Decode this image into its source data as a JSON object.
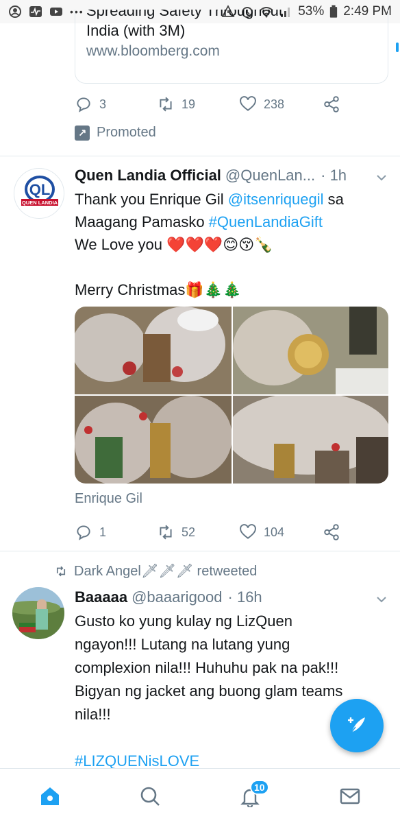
{
  "status_bar": {
    "battery": "53%",
    "time": "2:49 PM",
    "dots": "•••"
  },
  "promo_tweet": {
    "card_title_clipped": "Spreading Safety Throughout",
    "card_title": "India (with 3M)",
    "card_domain": "www.bloomberg.com",
    "replies": "3",
    "retweets": "19",
    "likes": "238",
    "promoted_label": "Promoted"
  },
  "tweet1": {
    "name": "Quen Landia Official",
    "handle": "@QuenLan...",
    "time": "· 1h",
    "avatar_text": "QL",
    "avatar_subtext": "QUEN LANDIA",
    "text_line1_pre": "Thank you Enrique Gil ",
    "text_line1_link": "@itsenriquegil",
    "text_line1_post": " sa",
    "text_line2_pre": "Maagang Pamasko ",
    "text_line2_link": "#QuenLandiaGift",
    "text_line3": "We Love you ❤️❤️❤️😊😚🍾",
    "text_line4": "Merry Christmas🎁🎄🎄",
    "tagged": "Enrique Gil",
    "replies": "1",
    "retweets": "52",
    "likes": "104"
  },
  "tweet2": {
    "retweeted_by": "Dark Angel🗡🗡🗡 retweeted",
    "name": "Baaaaa",
    "handle": "@baaarigood",
    "time": "· 16h",
    "text_lines": [
      "Gusto ko yung kulay ng LizQuen",
      "ngayon!!! Lutang na lutang yung",
      "complexion nila!!! Huhuhu pak na pak!!!",
      "Bigyan ng jacket ang buong glam teams",
      "nila!!!"
    ],
    "hashtag": "#LIZQUENisLOVE"
  },
  "tabbar": {
    "notifications_badge": "10"
  },
  "colors": {
    "accent": "#1da1f2",
    "secondary_text": "#657786",
    "divider": "#e1e8ed"
  },
  "icons": [
    "home-icon",
    "search-icon",
    "bell-icon",
    "mail-icon",
    "compose-icon",
    "reply-icon",
    "retweet-icon",
    "like-icon",
    "share-icon",
    "chevron-down-icon",
    "promoted-icon"
  ]
}
